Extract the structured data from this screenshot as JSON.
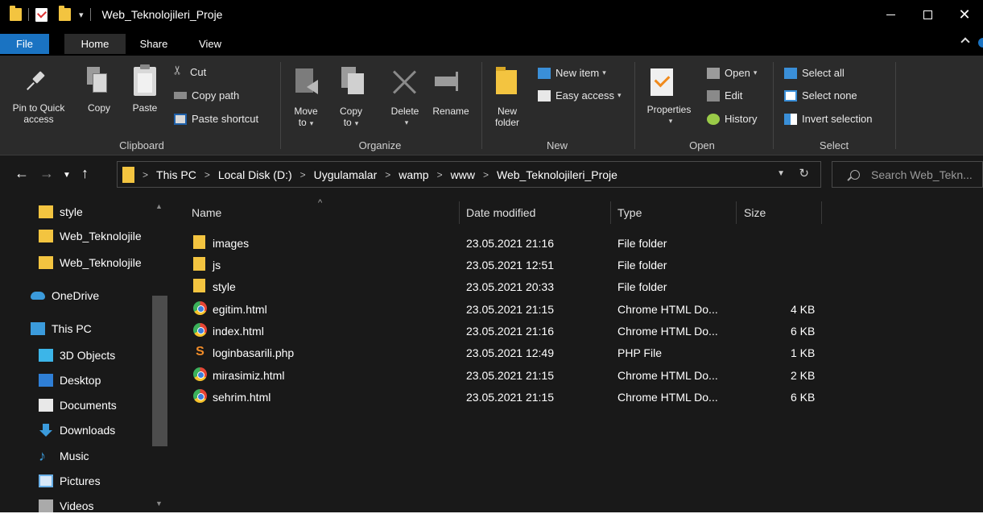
{
  "window": {
    "title": "Web_Teknolojileri_Proje"
  },
  "tabs": {
    "file": "File",
    "home": "Home",
    "share": "Share",
    "view": "View"
  },
  "ribbon": {
    "clipboard": {
      "label": "Clipboard",
      "pin_line1": "Pin to Quick",
      "pin_line2": "access",
      "copy": "Copy",
      "paste": "Paste",
      "cut": "Cut",
      "copy_path": "Copy path",
      "paste_shortcut": "Paste shortcut"
    },
    "organize": {
      "label": "Organize",
      "move_line1": "Move",
      "move_line2": "to",
      "copy_line1": "Copy",
      "copy_line2": "to",
      "delete": "Delete",
      "rename": "Rename"
    },
    "new": {
      "label": "New",
      "new_folder_line1": "New",
      "new_folder_line2": "folder",
      "new_item": "New item",
      "easy_access": "Easy access"
    },
    "open": {
      "label": "Open",
      "properties": "Properties",
      "open": "Open",
      "edit": "Edit",
      "history": "History"
    },
    "select": {
      "label": "Select",
      "select_all": "Select all",
      "select_none": "Select none",
      "invert_selection": "Invert selection"
    }
  },
  "address": {
    "crumbs": [
      "This PC",
      "Local Disk (D:)",
      "Uygulamalar",
      "wamp",
      "www",
      "Web_Teknolojileri_Proje"
    ],
    "search_placeholder": "Search Web_Tekn..."
  },
  "navpane": {
    "items": [
      {
        "label": "style",
        "icon": "folder-icon"
      },
      {
        "label": "Web_Teknolojile",
        "icon": "folder-icon"
      },
      {
        "label": "Web_Teknolojile",
        "icon": "folder-icon"
      },
      {
        "label": "OneDrive",
        "icon": "onedrive-icon"
      },
      {
        "label": "This PC",
        "icon": "computer-icon"
      },
      {
        "label": "3D Objects",
        "icon": "3d-objects-icon"
      },
      {
        "label": "Desktop",
        "icon": "desktop-icon"
      },
      {
        "label": "Documents",
        "icon": "documents-icon"
      },
      {
        "label": "Downloads",
        "icon": "downloads-icon"
      },
      {
        "label": "Music",
        "icon": "music-icon"
      },
      {
        "label": "Pictures",
        "icon": "pictures-icon"
      },
      {
        "label": "Videos",
        "icon": "videos-icon"
      }
    ]
  },
  "filelist": {
    "columns": {
      "name": "Name",
      "date": "Date modified",
      "type": "Type",
      "size": "Size"
    },
    "rows": [
      {
        "name": "images",
        "date": "23.05.2021 21:16",
        "type": "File folder",
        "size": "",
        "icon": "folder-icon"
      },
      {
        "name": "js",
        "date": "23.05.2021 12:51",
        "type": "File folder",
        "size": "",
        "icon": "folder-icon"
      },
      {
        "name": "style",
        "date": "23.05.2021 20:33",
        "type": "File folder",
        "size": "",
        "icon": "folder-icon"
      },
      {
        "name": "egitim.html",
        "date": "23.05.2021 21:15",
        "type": "Chrome HTML Do...",
        "size": "4 KB",
        "icon": "chrome-icon"
      },
      {
        "name": "index.html",
        "date": "23.05.2021 21:16",
        "type": "Chrome HTML Do...",
        "size": "6 KB",
        "icon": "chrome-icon"
      },
      {
        "name": "loginbasarili.php",
        "date": "23.05.2021 12:49",
        "type": "PHP File",
        "size": "1 KB",
        "icon": "php-icon"
      },
      {
        "name": "mirasimiz.html",
        "date": "23.05.2021 21:15",
        "type": "Chrome HTML Do...",
        "size": "2 KB",
        "icon": "chrome-icon"
      },
      {
        "name": "sehrim.html",
        "date": "23.05.2021 21:15",
        "type": "Chrome HTML Do...",
        "size": "6 KB",
        "icon": "chrome-icon"
      }
    ]
  },
  "colors": {
    "accent": "#1a73c2",
    "folder": "#f3c440",
    "background": "#191919",
    "ribbon": "#2b2b2b"
  }
}
